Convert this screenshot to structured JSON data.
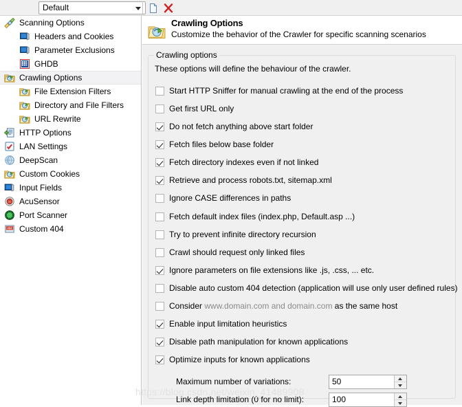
{
  "toolbar": {
    "profile_value": "Default",
    "profile_options": [
      "Default"
    ],
    "new_icon": "new-document-icon",
    "delete_icon": "delete-x-icon"
  },
  "sidebar": {
    "items": [
      {
        "label": "Scanning Options",
        "icon": "scanning-options-icon",
        "indent": 0,
        "selected": false
      },
      {
        "label": "Headers and Cookies",
        "icon": "headers-cookies-icon",
        "indent": 1,
        "selected": false
      },
      {
        "label": "Parameter Exclusions",
        "icon": "parameter-exclusions-icon",
        "indent": 1,
        "selected": false
      },
      {
        "label": "GHDB",
        "icon": "ghdb-icon",
        "indent": 1,
        "selected": false
      },
      {
        "label": "Crawling Options",
        "icon": "crawling-options-icon",
        "indent": 0,
        "selected": true
      },
      {
        "label": "File Extension Filters",
        "icon": "file-extension-filters-icon",
        "indent": 1,
        "selected": false
      },
      {
        "label": "Directory and File Filters",
        "icon": "directory-file-filters-icon",
        "indent": 1,
        "selected": false
      },
      {
        "label": "URL Rewrite",
        "icon": "url-rewrite-icon",
        "indent": 1,
        "selected": false
      },
      {
        "label": "HTTP Options",
        "icon": "http-options-icon",
        "indent": 0,
        "selected": false
      },
      {
        "label": "LAN Settings",
        "icon": "lan-settings-icon",
        "indent": 0,
        "selected": false
      },
      {
        "label": "DeepScan",
        "icon": "deepscan-icon",
        "indent": 0,
        "selected": false
      },
      {
        "label": "Custom Cookies",
        "icon": "custom-cookies-icon",
        "indent": 0,
        "selected": false
      },
      {
        "label": "Input Fields",
        "icon": "input-fields-icon",
        "indent": 0,
        "selected": false
      },
      {
        "label": "AcuSensor",
        "icon": "acusensor-icon",
        "indent": 0,
        "selected": false
      },
      {
        "label": "Port Scanner",
        "icon": "port-scanner-icon",
        "indent": 0,
        "selected": false
      },
      {
        "label": "Custom 404",
        "icon": "custom-404-icon",
        "indent": 0,
        "selected": false
      }
    ]
  },
  "header": {
    "icon": "crawling-options-icon",
    "title": "Crawling Options",
    "subtitle": "Customize the behavior of the Crawler for specific scanning scenarios"
  },
  "group": {
    "legend": "Crawling options",
    "description": "These options will define the behaviour of the crawler.",
    "checkboxes": [
      {
        "label": "Start HTTP Sniffer for manual crawling at the end of the process",
        "checked": false
      },
      {
        "label": "Get first URL only",
        "checked": false
      },
      {
        "label": "Do not fetch anything above start folder",
        "checked": true
      },
      {
        "label": "Fetch files below base folder",
        "checked": true
      },
      {
        "label": "Fetch directory indexes even if not linked",
        "checked": true
      },
      {
        "label": "Retrieve and process robots.txt, sitemap.xml",
        "checked": true
      },
      {
        "label": "Ignore CASE differences in paths",
        "checked": false
      },
      {
        "label": "Fetch default index files (index.php, Default.asp ...)",
        "checked": false
      },
      {
        "label": "Try to prevent infinite directory recursion",
        "checked": false
      },
      {
        "label": "Crawl should request only linked files",
        "checked": false
      },
      {
        "label": "Ignore parameters on file extensions like .js, .css, ... etc.",
        "checked": true
      },
      {
        "label": "Disable auto custom 404 detection (application will use only user defined rules)",
        "checked": false
      },
      {
        "label": "Consider www.domain.com and domain.com as the same host",
        "checked": false,
        "dim_from": "Consider ",
        "dim_text": "www.domain.com and domain.com",
        "dim_tail": " as the same host"
      },
      {
        "label": "Enable input limitation heuristics",
        "checked": true
      },
      {
        "label": "Disable path manipulation for known applications",
        "checked": true
      },
      {
        "label": "Optimize inputs for known applications",
        "checked": true
      }
    ],
    "spinners": [
      {
        "label": "Maximum number of variations:",
        "value": "50"
      },
      {
        "label": "Link depth limitation (0 for no limit):",
        "value": "100"
      }
    ]
  },
  "watermark": "https://blog.csdn.net/weixin_41489908"
}
